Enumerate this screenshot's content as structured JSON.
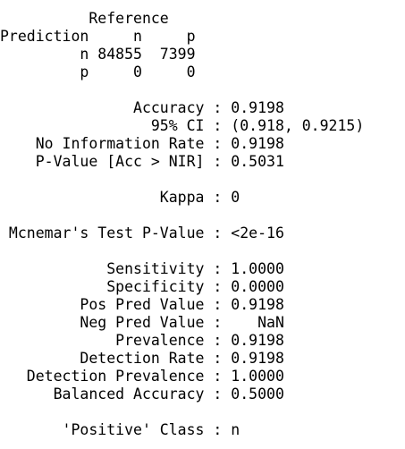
{
  "confusion_matrix": {
    "reference_header": "          Reference",
    "column_header": "Prediction     n     p",
    "row_n": "         n 84855  7399",
    "row_p": "         p     0     0"
  },
  "statistics": {
    "accuracy": "               Accuracy : 0.9198",
    "ci_95": "                 95% CI : (0.918, 0.9215)",
    "no_information_rate": "    No Information Rate : 0.9198",
    "p_value_acc_nir": "    P-Value [Acc > NIR] : 0.5031",
    "kappa": "                  Kappa : 0",
    "mcnemar": " Mcnemar's Test P-Value : <2e-16",
    "sensitivity": "            Sensitivity : 1.0000",
    "specificity": "            Specificity : 0.0000",
    "pos_pred_value": "         Pos Pred Value : 0.9198",
    "neg_pred_value": "         Neg Pred Value :    NaN",
    "prevalence": "             Prevalence : 0.9198",
    "detection_rate": "         Detection Rate : 0.9198",
    "detection_prevalence": "   Detection Prevalence : 1.0000",
    "balanced_accuracy": "      Balanced Accuracy : 0.5000",
    "positive_class": "       'Positive' Class : n"
  }
}
